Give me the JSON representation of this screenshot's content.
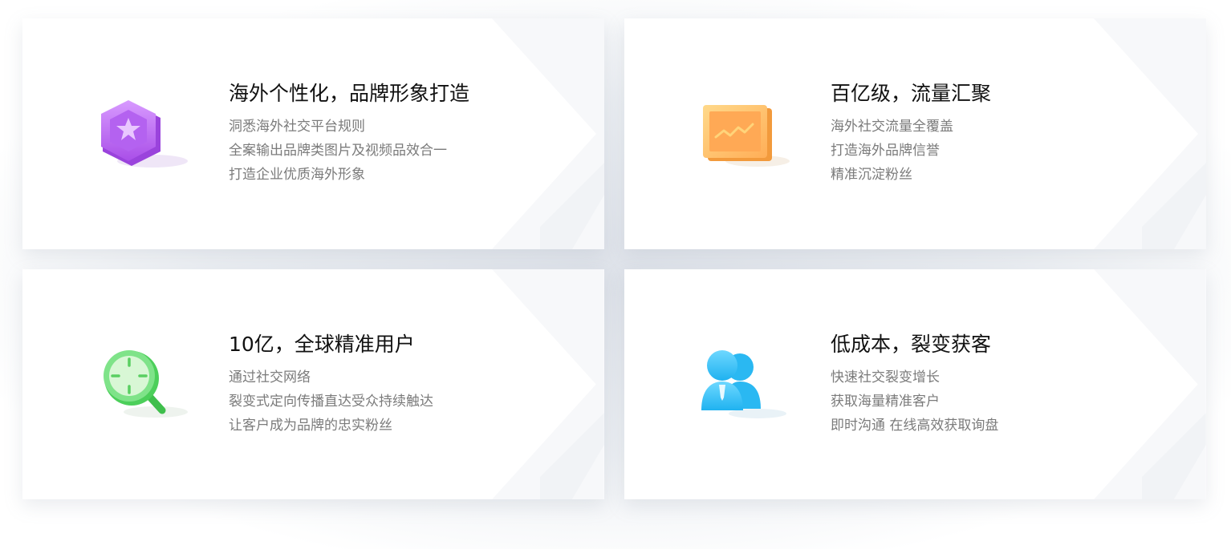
{
  "cards": [
    {
      "icon": "star-badge-icon",
      "title": "海外个性化，品牌形象打造",
      "lines": [
        "洞悉海外社交平台规则",
        "全案输出品牌类图片及视频品效合一",
        "打造企业优质海外形象"
      ]
    },
    {
      "icon": "trend-board-icon",
      "title": "百亿级，流量汇聚",
      "lines": [
        "海外社交流量全覆盖",
        "打造海外品牌信誉",
        "精准沉淀粉丝"
      ]
    },
    {
      "icon": "target-search-icon",
      "title": "10亿，全球精准用户",
      "lines": [
        "通过社交网络",
        "裂变式定向传播直达受众持续触达",
        "让客户成为品牌的忠实粉丝"
      ]
    },
    {
      "icon": "users-icon",
      "title": "低成本，裂变获客",
      "lines": [
        "快速社交裂变增长",
        "获取海量精准客户",
        "即时沟通 在线高效获取询盘"
      ]
    }
  ],
  "colors": {
    "purple": "#b86cf0",
    "orange": "#ffb347",
    "green": "#5bd96b",
    "blue": "#3fc6f7"
  }
}
